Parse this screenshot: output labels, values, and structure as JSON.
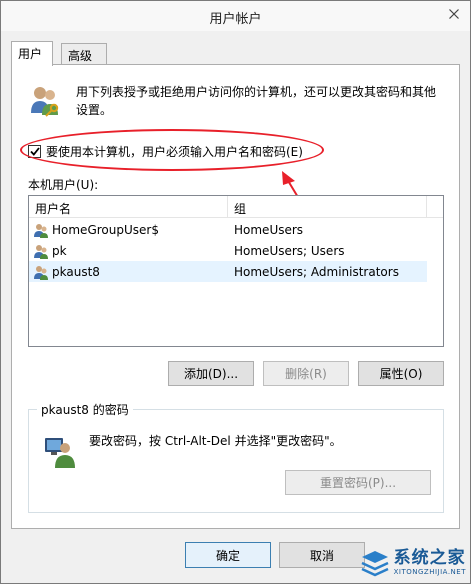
{
  "window": {
    "title": "用户帐户"
  },
  "tabs": [
    {
      "label": "用户",
      "active": true
    },
    {
      "label": "高级",
      "active": false
    }
  ],
  "intro": {
    "text": "用下列表授予或拒绝用户访问你的计算机，还可以更改其密码和其他设置。"
  },
  "require_login": {
    "label": "要使用本计算机，用户必须输入用户名和密码(E)",
    "checked": true
  },
  "local_users": {
    "label": "本机用户(U):",
    "columns": {
      "name": "用户名",
      "group": "组"
    },
    "rows": [
      {
        "name": "HomeGroupUser$",
        "group": "HomeUsers",
        "selected": false
      },
      {
        "name": "pk",
        "group": "HomeUsers; Users",
        "selected": false
      },
      {
        "name": "pkaust8",
        "group": "HomeUsers; Administrators",
        "selected": true
      }
    ]
  },
  "user_buttons": {
    "add": "添加(D)...",
    "remove": "删除(R)",
    "properties": "属性(O)"
  },
  "password_group": {
    "title": "pkaust8 的密码",
    "text": "要改密码，按 Ctrl-Alt-Del 并选择\"更改密码\"。",
    "reset_button": "重置密码(P)..."
  },
  "footer": {
    "ok": "确定",
    "cancel": "取消"
  },
  "watermark": {
    "main": "系统之家",
    "sub": "XITONGZHIJIA.NET"
  },
  "colors": {
    "annotation": "#e8202a",
    "selection": "#e5f3ff",
    "watermark": "#1a5a96"
  }
}
